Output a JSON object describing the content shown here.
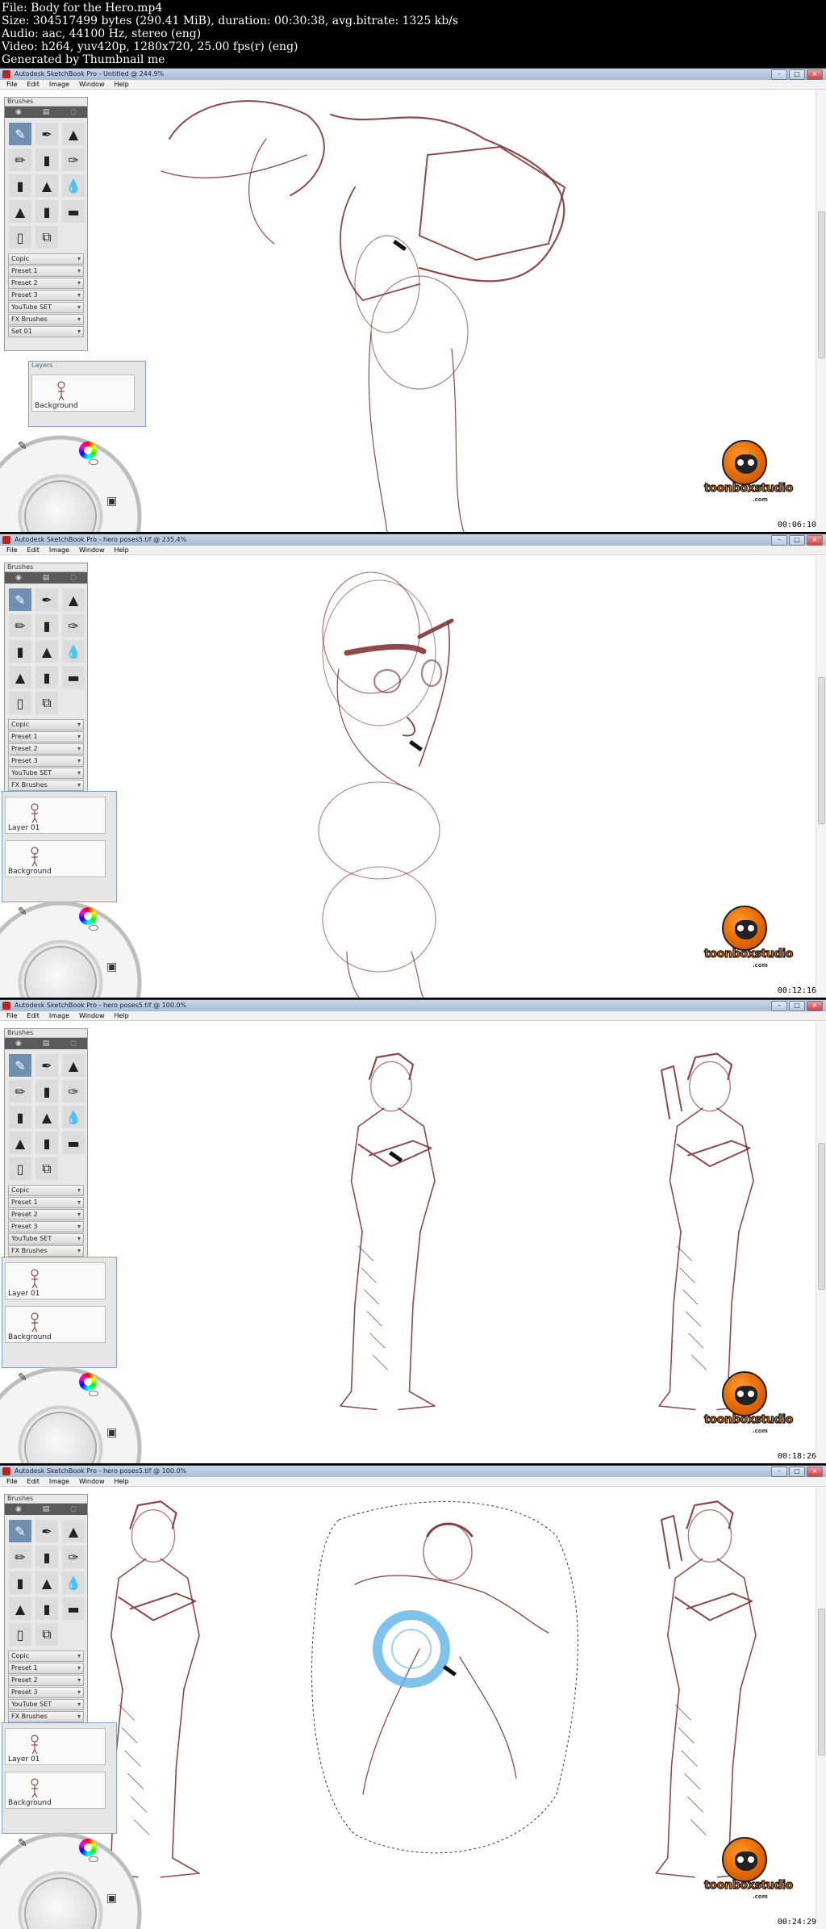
{
  "meta": {
    "line1": "File: Body for the Hero.mp4",
    "line2": "Size: 304517499 bytes (290.41 MiB), duration: 00:30:38, avg.bitrate: 1325 kb/s",
    "line3": "Audio: aac, 44100 Hz, stereo (eng)",
    "line4": "Video: h264, yuv420p, 1280x720, 25.00 fps(r) (eng)",
    "line5": "Generated by Thumbnail me"
  },
  "colors": {
    "sketch": "#7a2a2a",
    "accent": "#ff7a00",
    "selection_ring": "#5fb3e6"
  },
  "menu": [
    "File",
    "Edit",
    "Image",
    "Window",
    "Help"
  ],
  "brush_panel": {
    "title": "Brushes",
    "sets": [
      "Copic",
      "Preset 1",
      "Preset 2",
      "Preset 3",
      "YouTube SET",
      "FX Brushes",
      "Set 01"
    ]
  },
  "layers_panel": {
    "title": "Layers"
  },
  "logo": {
    "brand": "toonboxstudio",
    "suffix": ".com"
  },
  "frames": [
    {
      "title": "Autodesk SketchBook Pro - Untitled @ 244.9%",
      "timestamp": "00:06:10",
      "layers": [
        "Background"
      ]
    },
    {
      "title": "Autodesk SketchBook Pro - hero poses5.tif @ 235.4%",
      "timestamp": "00:12:16",
      "layers": [
        "Layer 01",
        "Background"
      ]
    },
    {
      "title": "Autodesk SketchBook Pro - hero poses5.tif @ 100.0%",
      "timestamp": "00:18:26",
      "layers": [
        "Layer 01",
        "Background"
      ]
    },
    {
      "title": "Autodesk SketchBook Pro - hero poses5.tif @ 100.0%",
      "timestamp": "00:24:29",
      "layers": [
        "Layer 01",
        "Background"
      ]
    }
  ]
}
